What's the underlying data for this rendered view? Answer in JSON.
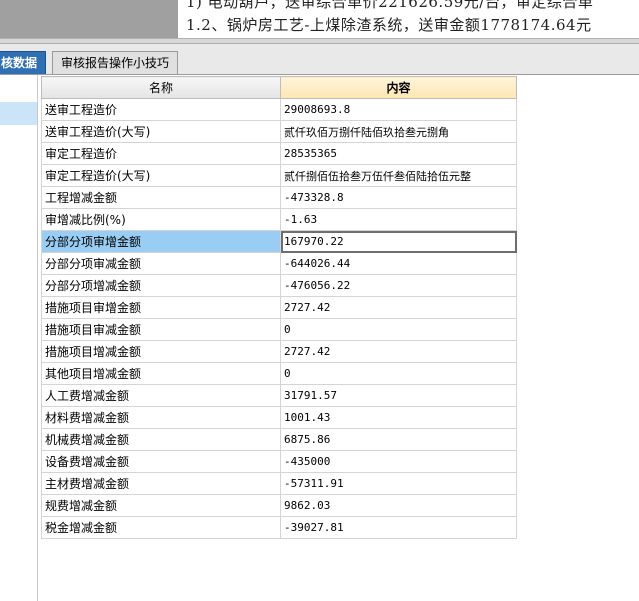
{
  "doc": {
    "line1": "1) 电动葫芦，送审综合单价221626.59元/台，审定综合单",
    "line2": "1.2、锅炉房工艺-上煤除渣系统，送审金额1778174.64元"
  },
  "tabs": [
    {
      "label": "核数据",
      "active": true
    },
    {
      "label": "审核报告操作小技巧",
      "active": false
    }
  ],
  "grid": {
    "headers": {
      "name": "名称",
      "content": "内容"
    },
    "rows": [
      {
        "name": "送审工程造价",
        "value": "29008693.8"
      },
      {
        "name": "送审工程造价(大写)",
        "value": "贰仟玖佰万捌仟陆佰玖拾叁元捌角"
      },
      {
        "name": "审定工程造价",
        "value": "28535365"
      },
      {
        "name": "审定工程造价(大写)",
        "value": "贰仟捌佰伍拾叁万伍仟叁佰陆拾伍元整"
      },
      {
        "name": "工程增减金额",
        "value": "-473328.8"
      },
      {
        "name": "审增减比例(%)",
        "value": "-1.63"
      },
      {
        "name": "分部分项审增金额",
        "value": "167970.22"
      },
      {
        "name": "分部分项审减金额",
        "value": "-644026.44"
      },
      {
        "name": "分部分项增减金额",
        "value": "-476056.22"
      },
      {
        "name": "措施项目审增金额",
        "value": "2727.42"
      },
      {
        "name": "措施项目审减金额",
        "value": "0"
      },
      {
        "name": "措施项目增减金额",
        "value": "2727.42"
      },
      {
        "name": "其他项目增减金额",
        "value": "0"
      },
      {
        "name": "人工费增减金额",
        "value": "31791.57"
      },
      {
        "name": "材料费增减金额",
        "value": "1001.43"
      },
      {
        "name": "机械费增减金额",
        "value": "6875.86"
      },
      {
        "name": "设备费增减金额",
        "value": "-435000"
      },
      {
        "name": "主材费增减金额",
        "value": "-57311.91"
      },
      {
        "name": "规费增减金额",
        "value": "9862.03"
      },
      {
        "name": "税金增减金额",
        "value": "-39027.81"
      }
    ],
    "selected_row": 6
  },
  "colors": {
    "tab_active": "#2f6fb3",
    "header_content": "#fde6b4",
    "selected_cell": "#99cdf4"
  }
}
